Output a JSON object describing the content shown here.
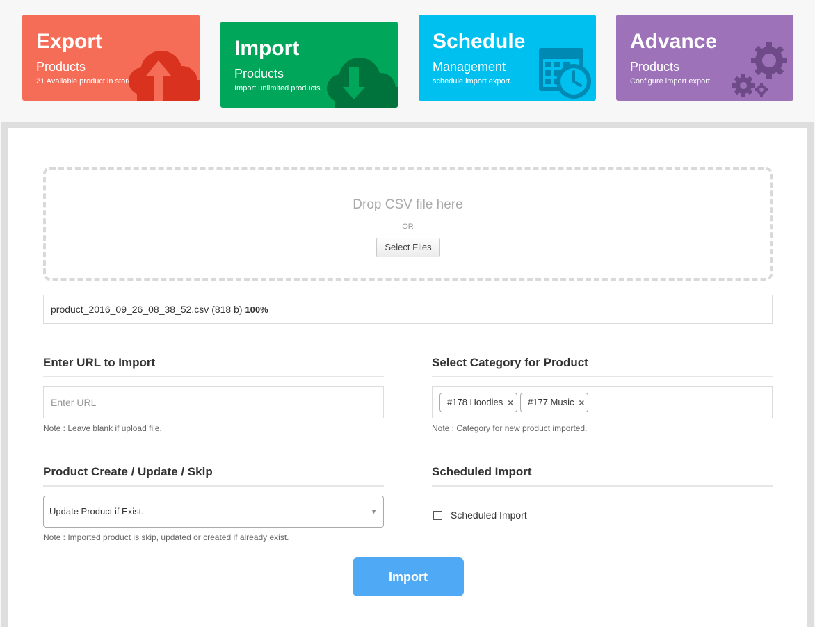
{
  "cards": [
    {
      "title": "Export",
      "subtitle": "Products",
      "description": "21 Available product in store.",
      "icon": "cloud-upload-icon",
      "color": "#f56d57"
    },
    {
      "title": "Import",
      "subtitle": "Products",
      "description": "Import unlimited products.",
      "icon": "cloud-download-icon",
      "color": "#00a65a"
    },
    {
      "title": "Schedule",
      "subtitle": "Management",
      "description": "schedule import export.",
      "icon": "calendar-clock-icon",
      "color": "#00c0ef"
    },
    {
      "title": "Advance",
      "subtitle": "Products",
      "description": "Configure import export",
      "icon": "gears-icon",
      "color": "#9d72b8"
    }
  ],
  "dropzone": {
    "title": "Drop CSV file here",
    "or": "OR",
    "button": "Select Files"
  },
  "file": {
    "name": "product_2016_09_26_08_38_52.csv (818 b)",
    "progress": "100%"
  },
  "url_section": {
    "title": "Enter URL to Import",
    "placeholder": "Enter URL",
    "note": "Note : Leave blank if upload file."
  },
  "category_section": {
    "title": "Select Category for Product",
    "tags": [
      "#178 Hoodies",
      "#177 Music"
    ],
    "remove_symbol": "×",
    "note": "Note : Category for new product imported."
  },
  "mode_section": {
    "title": "Product Create / Update / Skip",
    "selected": "Update Product if Exist.",
    "arrow": "▼",
    "note": "Note : Imported product is skip, updated or created if already exist."
  },
  "schedule_section": {
    "title": "Scheduled Import",
    "checkbox_label": "Scheduled Import",
    "checked": false
  },
  "import_button": "Import"
}
